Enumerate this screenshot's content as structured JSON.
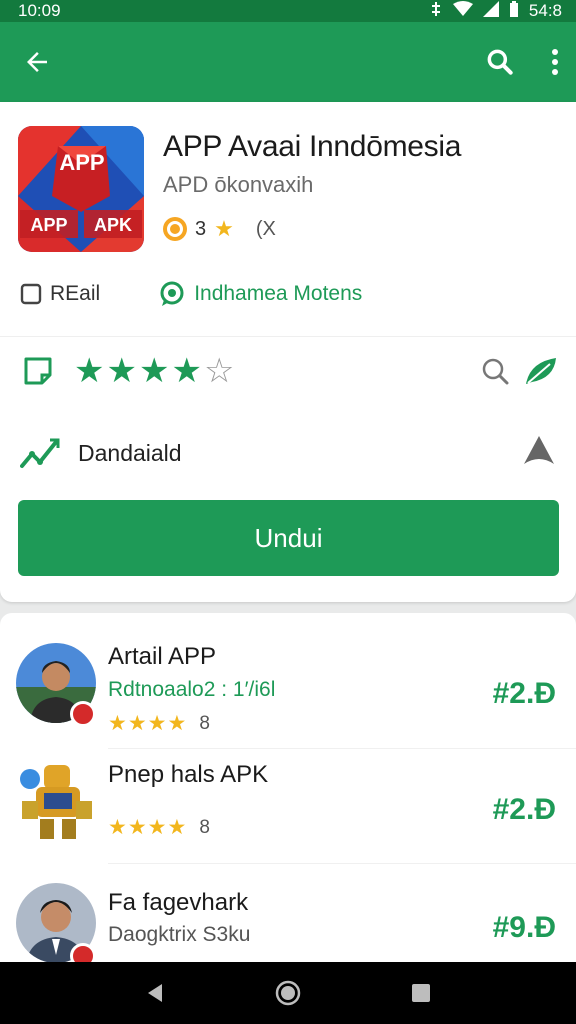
{
  "status_bar": {
    "time": "10:09",
    "right_text": "54:8"
  },
  "toolbar": {
    "back_icon": "arrow-left-icon",
    "search_icon": "search-icon",
    "menu_icon": "more-vert-icon"
  },
  "app": {
    "icon_text_top": "APP",
    "icon_text_left": "APP",
    "icon_text_right": "APK",
    "title": "APP Avaai Inndōmesia",
    "developer": "APD ōkonvaxih",
    "rating_value": "3",
    "rating_extra": "(X"
  },
  "tags": {
    "left_label": "REail",
    "right_label": "Indhamea Motens"
  },
  "rating_row": {
    "filled_stars": 4,
    "total_stars": 5
  },
  "downloads": {
    "label": "Dandaiald"
  },
  "install_button": {
    "label": "Undui"
  },
  "list": [
    {
      "title": "Artail APP",
      "subtitle": "Rdtnoaalo2 : 1′/i6l",
      "subtitle_green": true,
      "stars": 4,
      "rating_num": "8",
      "price": "#2.Ɖ"
    },
    {
      "title": "Pnep hals APK",
      "subtitle": "",
      "subtitle_green": false,
      "stars": 4,
      "rating_num": "8",
      "price": "#2.Ɖ"
    },
    {
      "title": "Fa fagevhark",
      "subtitle": "Daogktrix S3ku",
      "subtitle_green": false,
      "stars": 0,
      "rating_num": "",
      "price": "#9.Ɖ"
    }
  ],
  "colors": {
    "primary": "#1e9a57",
    "status": "#137a3e",
    "star": "#f2b61d"
  }
}
